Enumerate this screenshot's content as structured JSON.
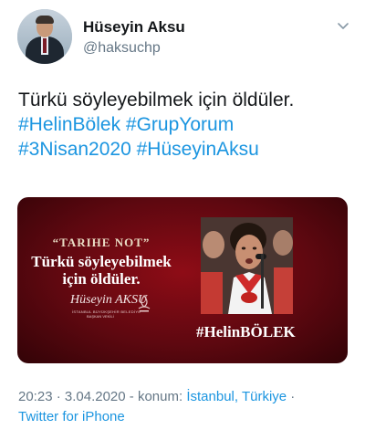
{
  "author": {
    "name": "Hüseyin Aksu",
    "handle": "@haksuchp",
    "avatar_icon": "profile-photo"
  },
  "tweet": {
    "text": "Türkü söyleyebilmek için öldüler.",
    "hashtags": [
      "#HelinBölek",
      "#GrupYorum",
      "#3Nisan2020",
      "#HüseyinAksu"
    ]
  },
  "media": {
    "note": "“TARIHE NOT”",
    "headline_lines": [
      "Türkü söyleyebilmek",
      "için öldüler."
    ],
    "signature": "Hüseyin AKSU",
    "signature_sub": "İSTANBUL BÜYÜKŞEHİR BELEDİYE",
    "signature_sub2": "BAŞKAN VEKİLİ",
    "photo_caption": "#HelinBÖLEK",
    "logo_icon": "ibb-logo-icon"
  },
  "meta": {
    "time": "20:23",
    "date": "3.04.2020",
    "location_prefix": "konum:",
    "location": "İstanbul, Türkiye",
    "source": "Twitter for iPhone",
    "separator": "·",
    "dash": "-"
  },
  "colors": {
    "link": "#1b95e0",
    "muted": "#657786",
    "text": "#14171a",
    "media_red": "#8e0c16"
  }
}
